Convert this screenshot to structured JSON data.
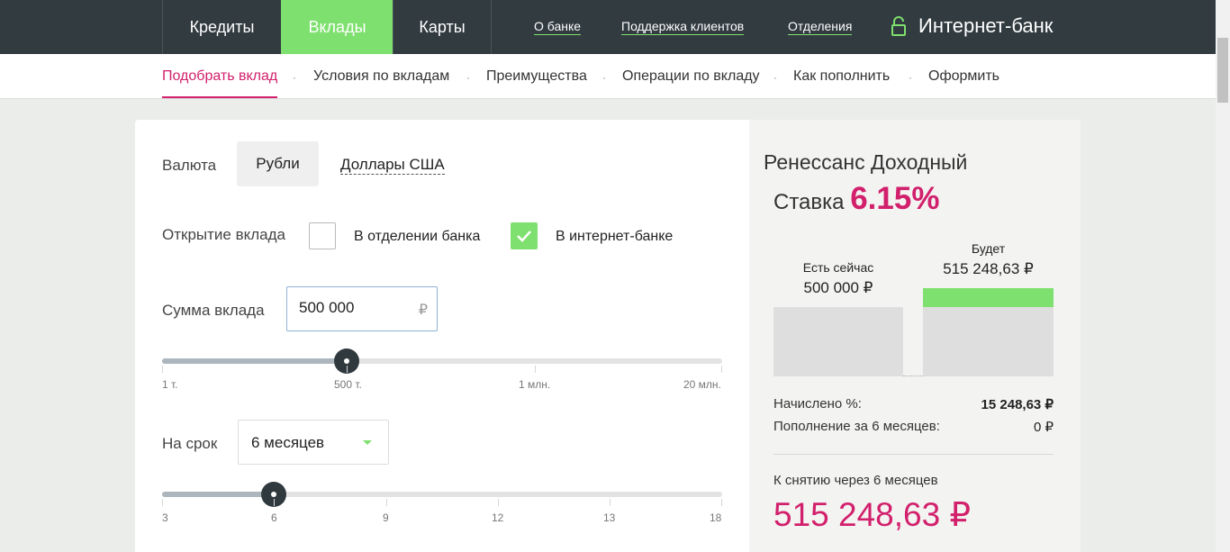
{
  "topnav": {
    "tabs": [
      {
        "label": "Кредиты",
        "active": false
      },
      {
        "label": "Вклады",
        "active": true
      },
      {
        "label": "Карты",
        "active": false
      }
    ],
    "links": [
      "О банке",
      "Поддержка клиентов",
      "Отделения"
    ],
    "internet_bank": "Интернет-банк",
    "lock_icon": "unlocked-padlock-icon"
  },
  "subnav": {
    "items": [
      {
        "label": "Подобрать вклад",
        "active": true
      },
      {
        "label": "Условия по вкладам",
        "active": false
      },
      {
        "label": "Преимущества",
        "active": false
      },
      {
        "label": "Операции по вкладу",
        "active": false
      },
      {
        "label": "Как пополнить",
        "active": false
      },
      {
        "label": "Оформить",
        "active": false
      }
    ],
    "separator": "·"
  },
  "calculator": {
    "currency": {
      "label": "Валюта",
      "options": [
        "Рубли",
        "Доллары США"
      ],
      "selected": "Рубли"
    },
    "opening": {
      "label": "Открытие вклада",
      "options": [
        {
          "label": "В отделении банка",
          "checked": false
        },
        {
          "label": "В интернет-банке",
          "checked": true
        }
      ]
    },
    "amount": {
      "label": "Сумма вклада",
      "value": "500 000",
      "currency_sign": "₽",
      "slider_fraction": 0.33,
      "ticks": [
        "1 т.",
        "500 т.",
        "1 млн.",
        "20 млн."
      ]
    },
    "term": {
      "label": "На срок",
      "selected": "6 месяцев",
      "slider_value": 6,
      "slider_min": 3,
      "slider_max": 18,
      "ticks": [
        "3",
        "6",
        "9",
        "12",
        "13",
        "18"
      ]
    }
  },
  "result": {
    "deposit_name": "Ренессанс Доходный",
    "rate_label": "Ставка",
    "rate_value": "6.15%",
    "now_label": "Есть сейчас",
    "now_value": "500 000 ₽",
    "future_label": "Будет",
    "future_value": "515 248,63 ₽",
    "accrued_label": "Начислено %:",
    "accrued_value": "15 248,63 ₽",
    "topup_label": "Пополнение за 6 месяцев:",
    "topup_value": "0 ₽",
    "payout_label": "К снятию через 6 месяцев",
    "payout_value": "515 248,63 ₽"
  },
  "colors": {
    "accent_green": "#7ee06e",
    "accent_pink": "#d2206c",
    "header_bg": "#313b40"
  }
}
